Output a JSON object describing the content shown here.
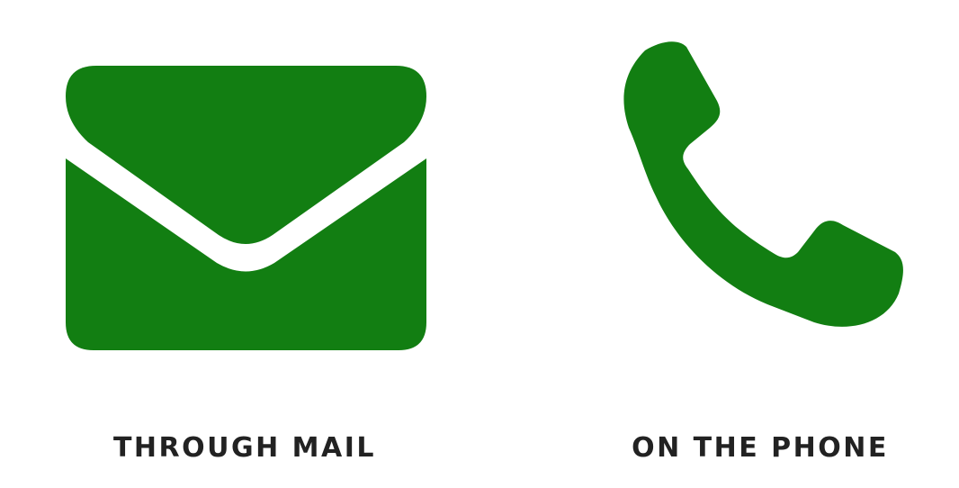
{
  "accent_color": "#127e12",
  "text_color": "#222222",
  "contact_options": [
    {
      "label": "THROUGH MAIL",
      "icon": "envelope-icon"
    },
    {
      "label": "ON THE PHONE",
      "icon": "phone-icon"
    }
  ]
}
